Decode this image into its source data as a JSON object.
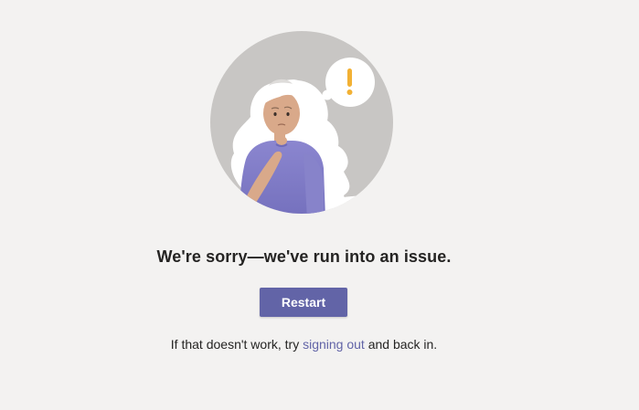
{
  "error": {
    "heading": "We're sorry—we've run into an issue.",
    "restart_label": "Restart",
    "help_prefix": "If that doesn't work, try ",
    "help_link": "signing out",
    "help_suffix": " and back in."
  },
  "illustration": {
    "alert_symbol": "!",
    "icon": "confused-person-illustration"
  },
  "colors": {
    "background": "#f3f2f1",
    "accent": "#6264a7",
    "text": "#252423",
    "alert": "#f2b134",
    "circle": "#c8c6c4"
  }
}
